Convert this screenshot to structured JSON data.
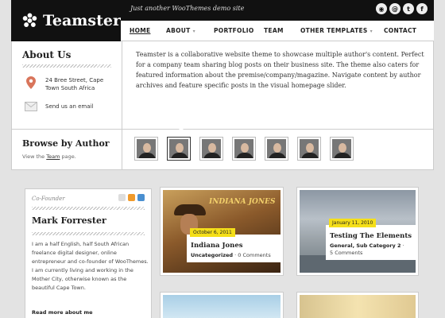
{
  "site": {
    "name": "Teamster",
    "tagline": "Just another WooThemes demo site",
    "social_icons": [
      "rss-icon",
      "email-icon",
      "twitter-icon",
      "facebook-icon"
    ]
  },
  "nav": {
    "items": [
      {
        "label": "HOME",
        "active": true,
        "has_dropdown": false
      },
      {
        "label": "ABOUT",
        "active": false,
        "has_dropdown": true
      },
      {
        "label": "PORTFOLIO",
        "active": false,
        "has_dropdown": false
      },
      {
        "label": "TEAM",
        "active": false,
        "has_dropdown": false
      },
      {
        "label": "OTHER TEMPLATES",
        "active": false,
        "has_dropdown": true
      },
      {
        "label": "CONTACT",
        "active": false,
        "has_dropdown": false
      }
    ]
  },
  "about": {
    "title": "About Us",
    "address_line1": "24 Bree Street, Cape",
    "address_line2": "Town South Africa",
    "email_label": "Send us an email"
  },
  "intro": {
    "text": "Teamster is a collaborative website theme to showcase multiple author's content. Perfect for a company team sharing blog posts on their business site. The theme also caters for featured information about the premise/company/magazine. Navigate content by author archives and feature specific posts in the visual homepage slider."
  },
  "browse": {
    "title": "Browse by Author",
    "view_prefix": "View the",
    "team_link": "Team",
    "view_suffix": "page.",
    "author_count": 7,
    "selected_index": 1
  },
  "profile": {
    "role": "Co-Founder",
    "name": "Mark Forrester",
    "bio": "I am a half English, half South African freelance digital designer, online entrepreneur and co-founder of WooThemes. I am currently living and working in the Mother City, otherwise known as the beautiful Cape Town.",
    "read_more": "Read more about me"
  },
  "posts": [
    {
      "date": "October 6, 2011",
      "title": "Indiana Jones",
      "category": "Uncategorized",
      "comments": "0 Comments",
      "image_text": "INDIANA JONES"
    },
    {
      "date": "January 11, 2010",
      "title": "Testing The Elements",
      "category": "General, Sub Category 2",
      "comments": "5 Comments"
    }
  ],
  "colors": {
    "header_bg": "#111111",
    "date_badge": "#f5df19",
    "page_bg": "#e3e3e3"
  }
}
